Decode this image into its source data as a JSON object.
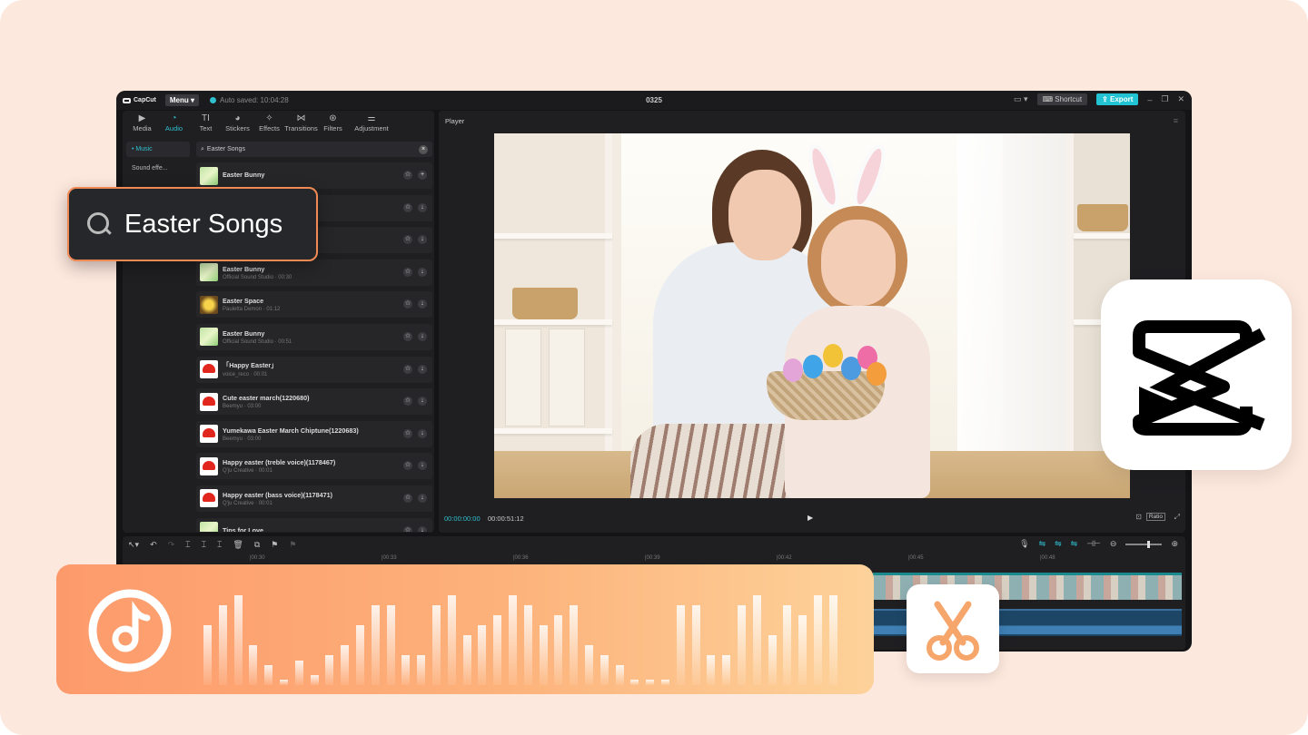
{
  "titlebar": {
    "logo": "CapCut",
    "menu_label": "Menu",
    "autosave": "Auto saved: 10:04:28",
    "project_title": "0325",
    "shortcut_label": "Shortcut",
    "export_label": "Export"
  },
  "toolbar": {
    "items": [
      {
        "label": "Media",
        "icon": "media-icon"
      },
      {
        "label": "Audio",
        "icon": "audio-icon"
      },
      {
        "label": "Text",
        "icon": "text-icon"
      },
      {
        "label": "Stickers",
        "icon": "sticker-icon"
      },
      {
        "label": "Effects",
        "icon": "effects-icon"
      },
      {
        "label": "Transitions",
        "icon": "transitions-icon"
      },
      {
        "label": "Filters",
        "icon": "filters-icon"
      },
      {
        "label": "Adjustment",
        "icon": "adjustment-icon"
      }
    ]
  },
  "sidebar": {
    "items": [
      {
        "label": "• Music"
      },
      {
        "label": "Sound effe..."
      }
    ]
  },
  "search": {
    "value": "Easter Songs"
  },
  "songs": [
    {
      "title": "Easter Bunny",
      "sub": "",
      "thumb": "bunny"
    },
    {
      "title": "",
      "sub": "",
      "thumb": "bunny"
    },
    {
      "title": "",
      "sub": "",
      "thumb": "bunny"
    },
    {
      "title": "Easter Bunny",
      "sub": "Official Sound Studio · 00:30",
      "thumb": "bunny"
    },
    {
      "title": "Easter Space",
      "sub": "Pauletta Demon · 01:12",
      "thumb": "space"
    },
    {
      "title": "Easter Bunny",
      "sub": "Official Sound Studio · 00:51",
      "thumb": "bunny"
    },
    {
      "title": "「Happy Easter」",
      "sub": "voice_reco · 00:01",
      "thumb": "red"
    },
    {
      "title": "Cute easter march(1220680)",
      "sub": "Beemyu · 03:00",
      "thumb": "red"
    },
    {
      "title": "Yumekawa Easter March Chiptune(1220683)",
      "sub": "Beemyu · 03:00",
      "thumb": "red"
    },
    {
      "title": "Happy easter (treble voice)(1178467)",
      "sub": "Q'ju Creative · 00:01",
      "thumb": "red"
    },
    {
      "title": "Happy easter (bass voice)(1178471)",
      "sub": "Q'ju Creative · 00:01",
      "thumb": "red"
    },
    {
      "title": "Tips for Love",
      "sub": "",
      "thumb": "bunny"
    }
  ],
  "player": {
    "title": "Player",
    "current_time": "00:00:00:00",
    "total_time": "00:00:51:12",
    "ratio_label": "Ratio"
  },
  "timeline": {
    "ruler": [
      "|00:30",
      "|00:33",
      "|00:36",
      "|00:39",
      "|00:42",
      "|00:45",
      "|00:48"
    ]
  },
  "overlay": {
    "search_text": "Easter Songs"
  },
  "audio_banner": {
    "bars": [
      0.6,
      0.8,
      0.9,
      0.4,
      0.2,
      0.05,
      0.25,
      0.1,
      0.3,
      0.4,
      0.6,
      0.8,
      0.8,
      0.3,
      0.3,
      0.8,
      0.9,
      0.5,
      0.6,
      0.7,
      0.9,
      0.8,
      0.6,
      0.7,
      0.8,
      0.4,
      0.3,
      0.2,
      0.05,
      0.05,
      0.05,
      0.8,
      0.8,
      0.3,
      0.3,
      0.8,
      0.9,
      0.5,
      0.8,
      0.7,
      0.9,
      0.9
    ]
  },
  "colors": {
    "accent": "#22c3d3",
    "banner": "#fd9a6b",
    "highlight": "#f08a55"
  }
}
